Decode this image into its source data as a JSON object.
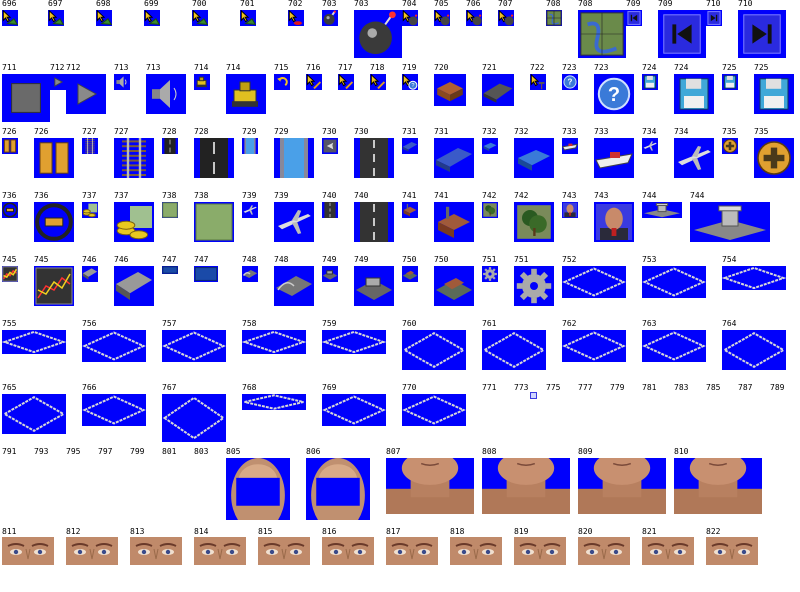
{
  "colors": {
    "background": "#0000fc",
    "diamond": "#d8d8d8"
  },
  "row1": [
    {
      "label": "696",
      "icon": "arrow-cursor-icon"
    },
    {
      "label": "697",
      "icon": "arrow-cursor-icon"
    },
    {
      "label": "698",
      "icon": "arrow-cursor-icon"
    },
    {
      "label": "699",
      "icon": "arrow-cursor-icon"
    },
    {
      "label": "700",
      "icon": "arrow-cursor-icon"
    },
    {
      "label": "701",
      "icon": "arrow-cursor-icon"
    },
    {
      "label": "702",
      "icon": "arrow-red-button-icon"
    },
    {
      "label": "703",
      "icon": "bomb-icon"
    },
    {
      "label": "703",
      "icon": "bomb-icon"
    },
    {
      "label": "704",
      "icon": "arrow-bomb-icon"
    },
    {
      "label": "705",
      "icon": "arrow-bomb-icon"
    },
    {
      "label": "706",
      "icon": "arrow-bomb-icon"
    },
    {
      "label": "707",
      "icon": "arrow-bomb-icon"
    },
    {
      "label": "708",
      "icon": "map-icon"
    },
    {
      "label": "708",
      "icon": "map-icon"
    },
    {
      "label": "709",
      "icon": "skip-back-icon"
    },
    {
      "label": "709",
      "icon": "skip-back-icon"
    },
    {
      "label": "710",
      "icon": "skip-forward-icon"
    },
    {
      "label": "710",
      "icon": "skip-forward-icon"
    }
  ],
  "row2": [
    {
      "label": "711",
      "icon": "stop-icon"
    },
    {
      "label": "712",
      "icon": "play-icon"
    },
    {
      "label": "712",
      "icon": "play-icon"
    },
    {
      "label": "713",
      "icon": "speaker-icon"
    },
    {
      "label": "713",
      "icon": "speaker-icon"
    },
    {
      "label": "714",
      "icon": "bulldozer-icon"
    },
    {
      "label": "714",
      "icon": "bulldozer-icon"
    },
    {
      "label": "715",
      "icon": "undo-icon"
    },
    {
      "label": "716",
      "icon": "arrow-pencil-icon"
    },
    {
      "label": "717",
      "icon": "arrow-pencil-icon"
    },
    {
      "label": "718",
      "icon": "arrow-pencil-icon"
    },
    {
      "label": "719",
      "icon": "arrow-help-icon"
    },
    {
      "label": "720",
      "icon": "building-icon"
    },
    {
      "label": "721",
      "icon": "platform-icon"
    },
    {
      "label": "722",
      "icon": "arrow-hammer-icon"
    },
    {
      "label": "723",
      "icon": "help-icon"
    },
    {
      "label": "723",
      "icon": "help-icon"
    },
    {
      "label": "724",
      "icon": "floppy-disk-icon"
    },
    {
      "label": "724",
      "icon": "floppy-disk-icon"
    },
    {
      "label": "725",
      "icon": "floppy-disk-icon"
    },
    {
      "label": "725",
      "icon": "floppy-disk-icon"
    }
  ],
  "row3": [
    {
      "label": "726",
      "icon": "pause-icon"
    },
    {
      "label": "726",
      "icon": "pause-icon"
    },
    {
      "label": "727",
      "icon": "rail-track-icon"
    },
    {
      "label": "727",
      "icon": "rail-track-icon"
    },
    {
      "label": "728",
      "icon": "road-icon"
    },
    {
      "label": "728",
      "icon": "road-icon"
    },
    {
      "label": "729",
      "icon": "waterway-icon"
    },
    {
      "label": "729",
      "icon": "waterway-icon"
    },
    {
      "label": "730",
      "icon": "airport-icon"
    },
    {
      "label": "730",
      "icon": "runway-icon"
    },
    {
      "label": "731",
      "icon": "train-icon"
    },
    {
      "label": "731",
      "icon": "train-icon"
    },
    {
      "label": "732",
      "icon": "truck-icon"
    },
    {
      "label": "732",
      "icon": "truck-icon"
    },
    {
      "label": "733",
      "icon": "ship-icon"
    },
    {
      "label": "733",
      "icon": "ship-icon"
    },
    {
      "label": "734",
      "icon": "aircraft-icon"
    },
    {
      "label": "734",
      "icon": "aircraft-icon"
    },
    {
      "label": "735",
      "icon": "add-icon"
    },
    {
      "label": "735",
      "icon": "add-icon"
    }
  ],
  "row4": [
    {
      "label": "736",
      "icon": "sign-icon"
    },
    {
      "label": "736",
      "icon": "sign-icon"
    },
    {
      "label": "737",
      "icon": "coins-icon"
    },
    {
      "label": "737",
      "icon": "coins-icon"
    },
    {
      "label": "738",
      "icon": "grass-icon"
    },
    {
      "label": "738",
      "icon": "grass-icon"
    },
    {
      "label": "739",
      "icon": "airplane-icon"
    },
    {
      "label": "739",
      "icon": "airplane-icon"
    },
    {
      "label": "740",
      "icon": "runway-icon"
    },
    {
      "label": "740",
      "icon": "runway-icon"
    },
    {
      "label": "741",
      "icon": "factory-icon"
    },
    {
      "label": "741",
      "icon": "factory-icon"
    },
    {
      "label": "742",
      "icon": "tree-icon"
    },
    {
      "label": "742",
      "icon": "tree-icon"
    },
    {
      "label": "743",
      "icon": "person-icon"
    },
    {
      "label": "743",
      "icon": "person-icon"
    },
    {
      "label": "744",
      "icon": "airport-terminal-icon"
    },
    {
      "label": "744",
      "icon": "airport-terminal-icon"
    }
  ],
  "row5": [
    {
      "label": "745",
      "icon": "graph-icon"
    },
    {
      "label": "745",
      "icon": "graph-icon"
    },
    {
      "label": "746",
      "icon": "conveyor-icon"
    },
    {
      "label": "746",
      "icon": "conveyor-icon"
    },
    {
      "label": "747",
      "icon": "blue-block-icon"
    },
    {
      "label": "747",
      "icon": "blue-block-icon"
    },
    {
      "label": "748",
      "icon": "bridge-icon"
    },
    {
      "label": "748",
      "icon": "bridge-icon"
    },
    {
      "label": "749",
      "icon": "depot-icon"
    },
    {
      "label": "749",
      "icon": "depot-icon"
    },
    {
      "label": "750",
      "icon": "station-icon"
    },
    {
      "label": "750",
      "icon": "station-icon"
    },
    {
      "label": "751",
      "icon": "gear-icon"
    },
    {
      "label": "751",
      "icon": "gear-icon"
    },
    {
      "label": "752",
      "icon": "diamond-icon"
    },
    {
      "label": "753",
      "icon": "diamond-icon"
    },
    {
      "label": "754",
      "icon": "diamond-icon"
    }
  ],
  "row6": [
    {
      "label": "755"
    },
    {
      "label": "756"
    },
    {
      "label": "757"
    },
    {
      "label": "758"
    },
    {
      "label": "759"
    },
    {
      "label": "760"
    },
    {
      "label": "761"
    },
    {
      "label": "762"
    },
    {
      "label": "763"
    },
    {
      "label": "764"
    }
  ],
  "row7": [
    {
      "label": "765"
    },
    {
      "label": "766"
    },
    {
      "label": "767"
    },
    {
      "label": "768"
    },
    {
      "label": "769"
    },
    {
      "label": "770"
    }
  ],
  "row7_empty": [
    "771",
    "773",
    "775",
    "777",
    "779",
    "781",
    "783",
    "785",
    "787",
    "789"
  ],
  "row8_empty": [
    "791",
    "793",
    "795",
    "797",
    "799",
    "801",
    "803"
  ],
  "row8": [
    {
      "label": "805",
      "icon": "bald-head-icon"
    },
    {
      "label": "806",
      "icon": "bald-head-icon"
    },
    {
      "label": "807",
      "icon": "chin-neck-icon"
    },
    {
      "label": "808",
      "icon": "chin-neck-icon"
    },
    {
      "label": "809",
      "icon": "chin-neck-icon"
    },
    {
      "label": "810",
      "icon": "chin-neck-icon"
    }
  ],
  "row9": [
    {
      "label": "811"
    },
    {
      "label": "812"
    },
    {
      "label": "813"
    },
    {
      "label": "814"
    },
    {
      "label": "815"
    },
    {
      "label": "816"
    },
    {
      "label": "817"
    },
    {
      "label": "818"
    },
    {
      "label": "819"
    },
    {
      "label": "820"
    },
    {
      "label": "821"
    },
    {
      "label": "822"
    }
  ]
}
